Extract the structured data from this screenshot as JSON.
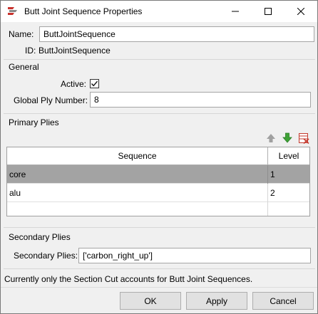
{
  "window": {
    "title": "Butt Joint Sequence Properties"
  },
  "fields": {
    "name_label": "Name:",
    "name_value": "ButtJointSequence",
    "id_label": "ID:",
    "id_value": "ButtJointSequence"
  },
  "general": {
    "heading": "General",
    "active_label": "Active:",
    "active_checked": true,
    "ply_label": "Global Ply Number:",
    "ply_value": "8"
  },
  "primary": {
    "heading": "Primary Plies",
    "columns": [
      "Sequence",
      "Level"
    ],
    "rows": [
      {
        "sequence": "core",
        "level": "1",
        "selected": true
      },
      {
        "sequence": "alu",
        "level": "2",
        "selected": false
      },
      {
        "sequence": "",
        "level": "",
        "selected": false
      }
    ]
  },
  "secondary": {
    "heading": "Secondary Plies",
    "label": "Secondary Plies:",
    "value": "['carbon_right_up']"
  },
  "note": "Currently only the Section Cut accounts for Butt Joint Sequences.",
  "buttons": {
    "ok": "OK",
    "apply": "Apply",
    "cancel": "Cancel"
  },
  "colors": {
    "selected_row": "#a3a3a3",
    "move_up_icon": "#a0a0a0",
    "move_down_icon": "#3ea236",
    "delete_icon": "#c43b2f"
  },
  "icons": [
    "app-icon",
    "minimize-icon",
    "maximize-icon",
    "close-icon",
    "arrow-up-icon",
    "arrow-down-icon",
    "delete-icon"
  ]
}
